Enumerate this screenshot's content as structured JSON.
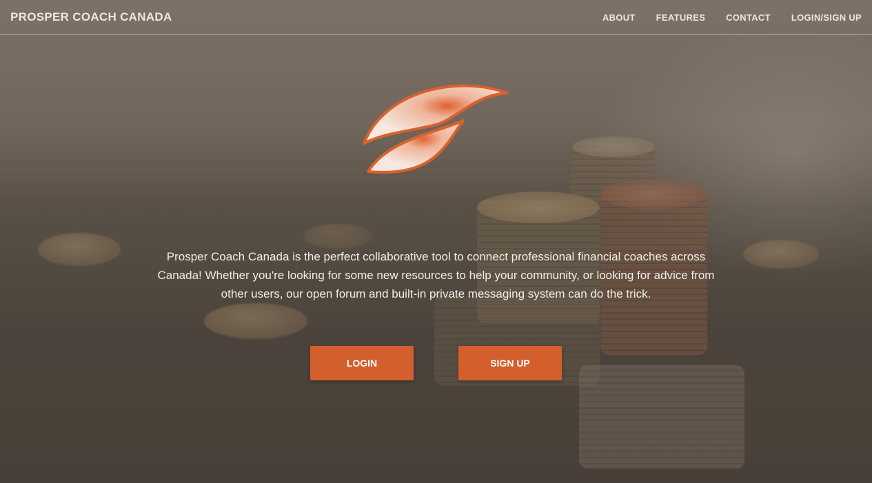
{
  "nav": {
    "brand": "PROSPER COACH CANADA",
    "links": [
      "ABOUT",
      "FEATURES",
      "CONTACT",
      "LOGIN/SIGN UP"
    ]
  },
  "hero": {
    "logo_icon": "leaf-icon",
    "tagline": "Prosper Coach Canada is the perfect collaborative tool to connect professional financial coaches across Canada! Whether you're looking for some new resources to help your community, or looking for advice from other users, our open forum and built-in private messaging system can do the trick.",
    "login_label": "LOGIN",
    "signup_label": "SIGN UP"
  },
  "colors": {
    "accent": "#d35f2c",
    "nav_text": "#ece7e2",
    "overlay": "#6b6258"
  }
}
